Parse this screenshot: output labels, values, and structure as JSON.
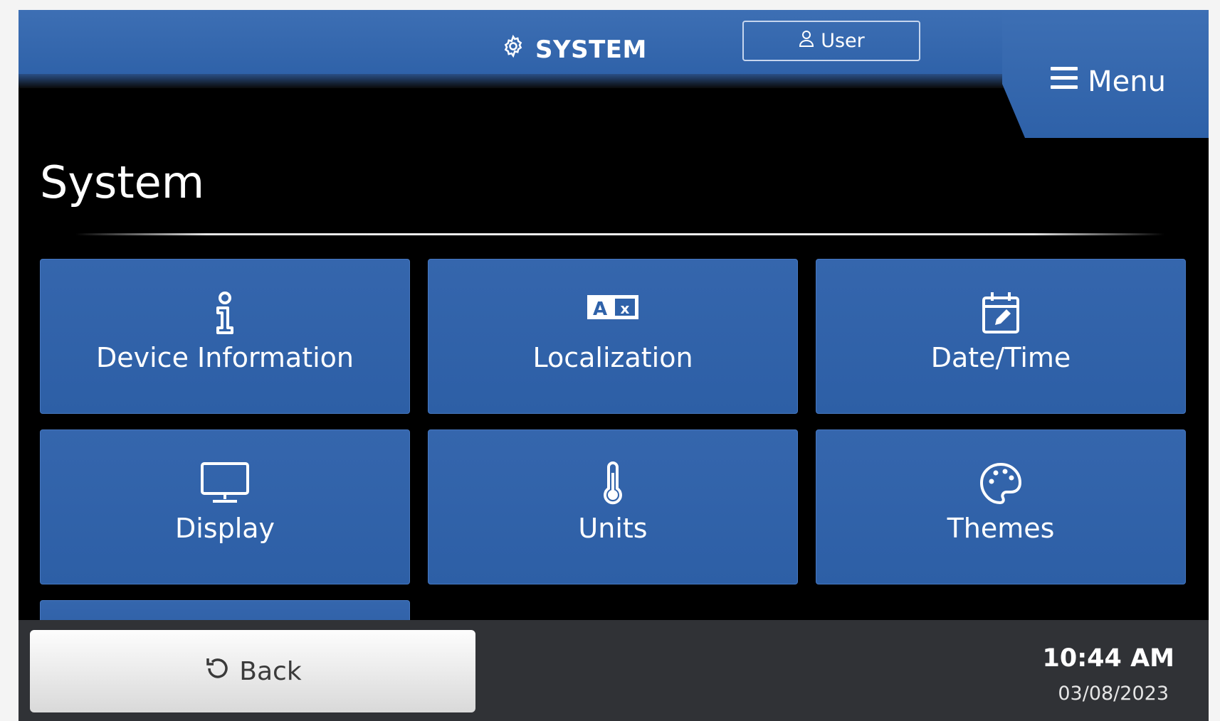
{
  "header": {
    "title": "SYSTEM",
    "title_icon": "gear-icon",
    "user_label": "User",
    "user_icon": "user-icon",
    "menu_label": "Menu",
    "menu_icon": "hamburger-icon"
  },
  "page": {
    "title": "System"
  },
  "tiles": [
    {
      "label": "Device Information",
      "icon": "info-icon"
    },
    {
      "label": "Localization",
      "icon": "translate-icon"
    },
    {
      "label": "Date/Time",
      "icon": "calendar-edit-icon"
    },
    {
      "label": "Display",
      "icon": "monitor-icon"
    },
    {
      "label": "Units",
      "icon": "thermometer-icon"
    },
    {
      "label": "Themes",
      "icon": "palette-icon"
    }
  ],
  "footer": {
    "back_label": "Back",
    "back_icon": "undo-icon",
    "time": "10:44 AM",
    "date": "03/08/2023"
  },
  "colors": {
    "header_blue": "#3d6fb4",
    "tile_blue": "#3566ad",
    "background": "#000000",
    "footer_bg": "#303236"
  }
}
